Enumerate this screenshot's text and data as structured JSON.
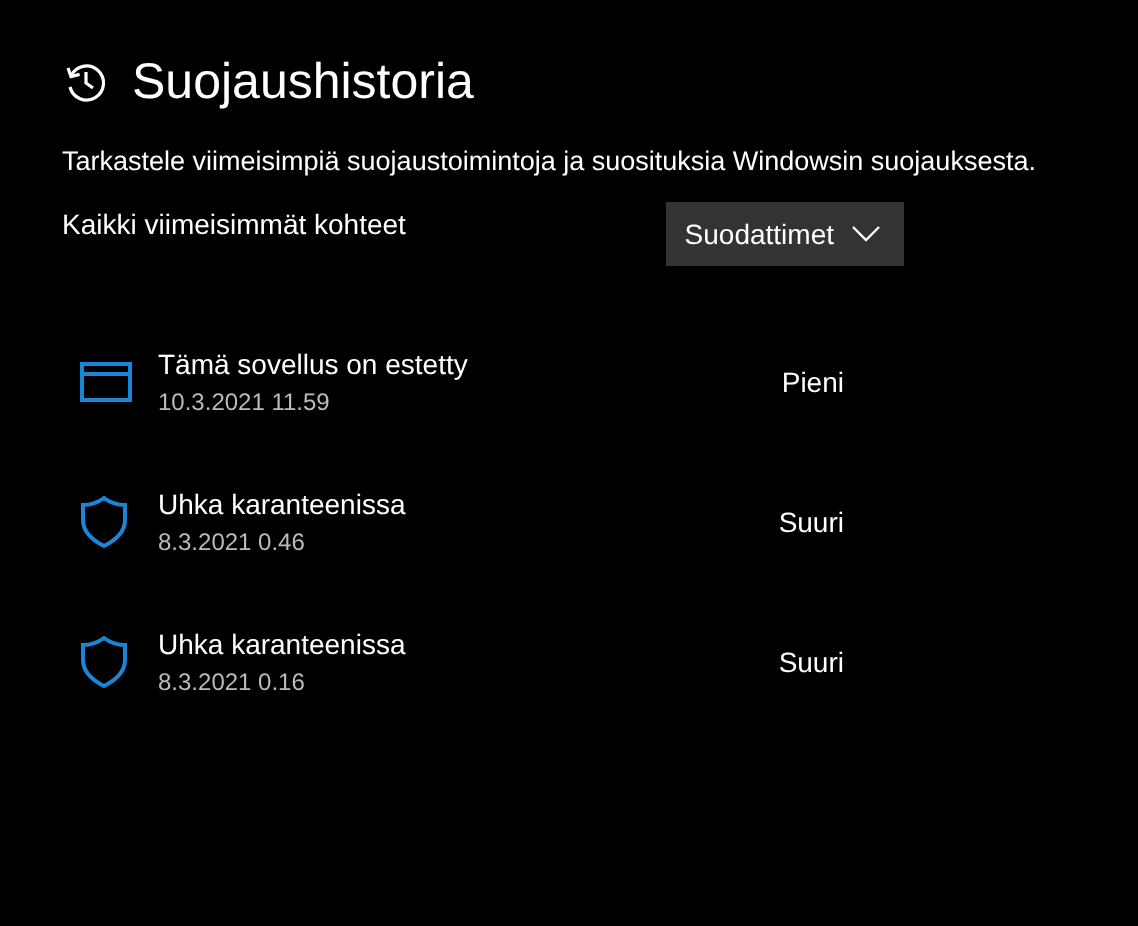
{
  "header": {
    "title": "Suojaushistoria",
    "description": "Tarkastele viimeisimpiä suojaustoimintoja ja suosituksia Windowsin suojauksesta."
  },
  "filter_bar": {
    "label": "Kaikki viimeisimmät kohteet",
    "button": "Suodattimet"
  },
  "items": [
    {
      "kind": "app",
      "title": "Tämä sovellus on estetty",
      "date": "10.3.2021 11.59",
      "severity": "Pieni"
    },
    {
      "kind": "threat",
      "title": "Uhka karanteenissa",
      "date": "8.3.2021 0.46",
      "severity": "Suuri"
    },
    {
      "kind": "threat",
      "title": "Uhka karanteenissa",
      "date": "8.3.2021 0.16",
      "severity": "Suuri"
    }
  ]
}
